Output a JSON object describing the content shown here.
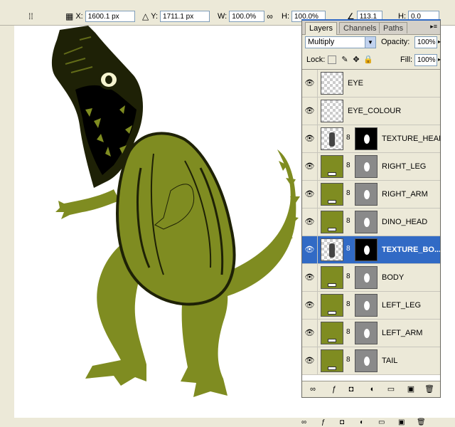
{
  "options_bar": {
    "x_label": "X:",
    "x_value": "1600.1 px",
    "y_label": "Y:",
    "y_value": "1711.1 px",
    "w_label": "W:",
    "w_value": "100.0%",
    "h_label": "H:",
    "h_value": "100.0%",
    "angle_value": "113.1",
    "hskew_label": "H:",
    "hskew_value": "0.0"
  },
  "panel": {
    "tabs": [
      {
        "label": "Layers"
      },
      {
        "label": "Channels"
      },
      {
        "label": "Paths"
      }
    ],
    "blend_mode": "Multiply",
    "opacity_label": "Opacity:",
    "opacity_value": "100%",
    "lock_label": "Lock:",
    "fill_label": "Fill:",
    "fill_value": "100%"
  },
  "layers": [
    {
      "name": "EYE",
      "thumb": "checker",
      "mask": "none",
      "selected": false
    },
    {
      "name": "EYE_COLOUR",
      "thumb": "checker",
      "mask": "none",
      "selected": false
    },
    {
      "name": "TEXTURE_HEAD",
      "thumb": "checker-figure",
      "mask": "black",
      "selected": false
    },
    {
      "name": "RIGHT_LEG",
      "thumb": "green",
      "mask": "grey",
      "selected": false
    },
    {
      "name": "RIGHT_ARM",
      "thumb": "green",
      "mask": "grey",
      "selected": false
    },
    {
      "name": "DINO_HEAD",
      "thumb": "green",
      "mask": "grey",
      "selected": false
    },
    {
      "name": "TEXTURE_BO...",
      "thumb": "checker-figure",
      "mask": "black",
      "selected": true
    },
    {
      "name": "BODY",
      "thumb": "green",
      "mask": "grey",
      "selected": false
    },
    {
      "name": "LEFT_LEG",
      "thumb": "green",
      "mask": "grey",
      "selected": false
    },
    {
      "name": "LEFT_ARM",
      "thumb": "green",
      "mask": "grey",
      "selected": false
    },
    {
      "name": "TAIL",
      "thumb": "green",
      "mask": "grey",
      "selected": false
    }
  ],
  "colors": {
    "dino_green": "#7f8c21",
    "dino_dark": "#1e2106",
    "selection_blue": "#316ac5"
  }
}
